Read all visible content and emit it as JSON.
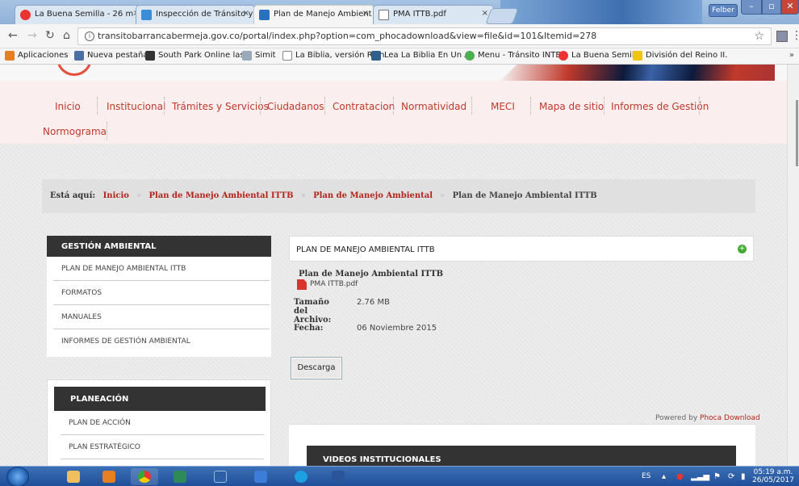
{
  "browser": {
    "tabs": [
      {
        "label": "La Buena Semilla - 26 m",
        "active": false
      },
      {
        "label": "Inspección de Tránsito y",
        "active": false
      },
      {
        "label": "Plan de Manejo Ambient",
        "active": true
      },
      {
        "label": "PMA ITTB.pdf",
        "active": false
      }
    ],
    "tab_close_glyph": "×",
    "window_user": "Felber",
    "url": "transitobarrancabermeja.gov.co/portal/index.php?option=com_phocadownload&view=file&id=101&Itemid=278",
    "bookmarks": [
      "Aplicaciones",
      "Nueva pestaña",
      "South Park Online las",
      "Simit",
      "La Biblia, versión Rein",
      "Lea La Biblia En Un A",
      "Menu - Tránsito INTE",
      "La Buena Semilla",
      "División del Reino II."
    ],
    "more_bookmarks": "»"
  },
  "site": {
    "menu": [
      "Inicio",
      "Institucional",
      "Trámites y Servicios",
      "Ciudadanos",
      "Contratacion",
      "Normatividad",
      "MECI",
      "Mapa de sitio",
      "Informes de Gestión",
      "Normograma"
    ],
    "breadcrumb": {
      "label": "Está aquí:",
      "links": [
        "Inicio",
        "Plan de Manejo Ambiental ITTB",
        "Plan de Manejo Ambiental"
      ],
      "current": "Plan de Manejo Ambiental ITTB",
      "separator": "»"
    },
    "sidebar_gestion": {
      "heading": "GESTIÓN AMBIENTAL",
      "items": [
        "PLAN DE MANEJO AMBIENTAL ITTB",
        "FORMATOS",
        "MANUALES",
        "INFORMES DE GESTIÓN AMBIENTAL"
      ]
    },
    "sidebar_planeacion": {
      "heading": "PLANEACIÓN",
      "items": [
        "PLAN DE ACCIÓN",
        "PLAN ESTRATÉGICO"
      ]
    },
    "content": {
      "title": "PLAN DE MANEJO AMBIENTAL ITTB",
      "file_title": "Plan de Manejo Ambiental ITTB",
      "file_name": "PMA ITTB.pdf",
      "size_label": "Tamaño del Archivo:",
      "size_value": "2.76 MB",
      "date_label": "Fecha:",
      "date_value": "06 Noviembre 2015",
      "download_label": "Descarga",
      "powered_prefix": "Powered by",
      "powered_brand": "Phoca Download",
      "videos_heading": "VIDEOS INSTITUCIONALES"
    }
  },
  "taskbar": {
    "language": "ES",
    "time": "05:19 a.m.",
    "date": "26/05/2017"
  },
  "colors": {
    "menu_link": "#c0392b",
    "breadcrumb_link": "#b5241b",
    "sidebar_heading_bg": "#333333",
    "accent_green": "#44aa33"
  }
}
